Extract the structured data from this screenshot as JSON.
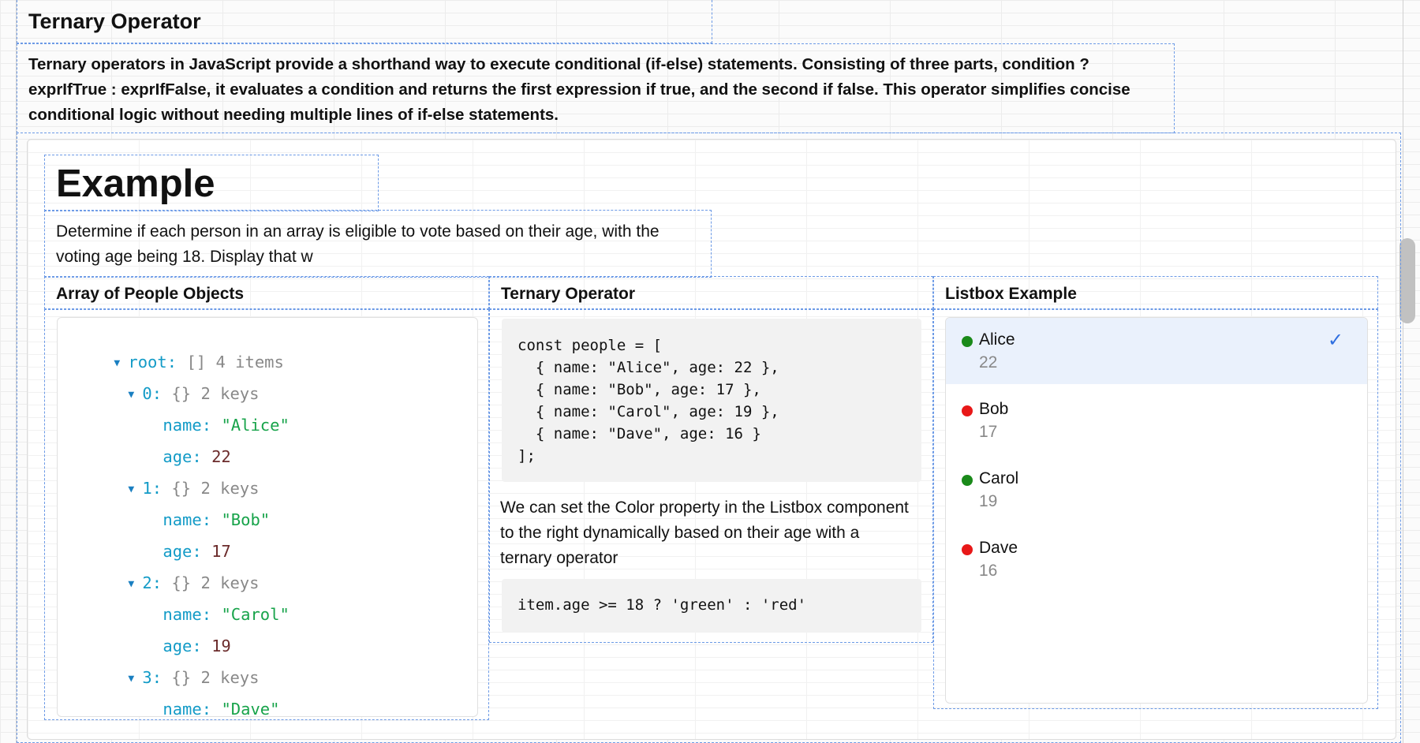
{
  "header": {
    "title": "Ternary Operator"
  },
  "intro": {
    "text": "Ternary operators in JavaScript provide a shorthand way to execute conditional (if-else) statements. Consisting of three parts, condition ? exprIfTrue : exprIfFalse, it evaluates a condition and returns the first expression if true, and the second if false. This operator simplifies concise conditional logic without needing multiple lines of if-else statements."
  },
  "example": {
    "title": "Example",
    "description": "Determine if each person in an array is eligible to vote based on their age, with the voting age being 18. Display that w"
  },
  "columns": {
    "col1": "Array of People Objects",
    "col2": "Ternary Operator",
    "col3": "Listbox Example"
  },
  "json_tree": {
    "root_key": "root:",
    "root_type": "[]",
    "root_count": "4 items",
    "items": [
      {
        "index": "0:",
        "type": "{}",
        "count": "2 keys",
        "name_key": "name:",
        "name_val": "\"Alice\"",
        "age_key": "age:",
        "age_val": "22"
      },
      {
        "index": "1:",
        "type": "{}",
        "count": "2 keys",
        "name_key": "name:",
        "name_val": "\"Bob\"",
        "age_key": "age:",
        "age_val": "17"
      },
      {
        "index": "2:",
        "type": "{}",
        "count": "2 keys",
        "name_key": "name:",
        "name_val": "\"Carol\"",
        "age_key": "age:",
        "age_val": "19"
      },
      {
        "index": "3:",
        "type": "{}",
        "count": "2 keys",
        "name_key": "name:",
        "name_val": "\"Dave\""
      }
    ]
  },
  "code": {
    "snippet": "const people = [\n  { name: \"Alice\", age: 22 },\n  { name: \"Bob\", age: 17 },\n  { name: \"Carol\", age: 19 },\n  { name: \"Dave\", age: 16 }\n];",
    "explanation": "We can set the Color property in the Listbox component to the right dynamically based on their age with a ternary operator",
    "expression": "item.age >= 18 ? 'green' : 'red'"
  },
  "listbox": {
    "items": [
      {
        "name": "Alice",
        "age": "22",
        "color": "#1a8a1a",
        "selected": true
      },
      {
        "name": "Bob",
        "age": "17",
        "color": "#e81818",
        "selected": false
      },
      {
        "name": "Carol",
        "age": "19",
        "color": "#1a8a1a",
        "selected": false
      },
      {
        "name": "Dave",
        "age": "16",
        "color": "#e81818",
        "selected": false
      }
    ]
  },
  "colors": {
    "accent": "#2f6fe0",
    "dashed_border": "#6c9ae6",
    "green": "#1a8a1a",
    "red": "#e81818"
  }
}
